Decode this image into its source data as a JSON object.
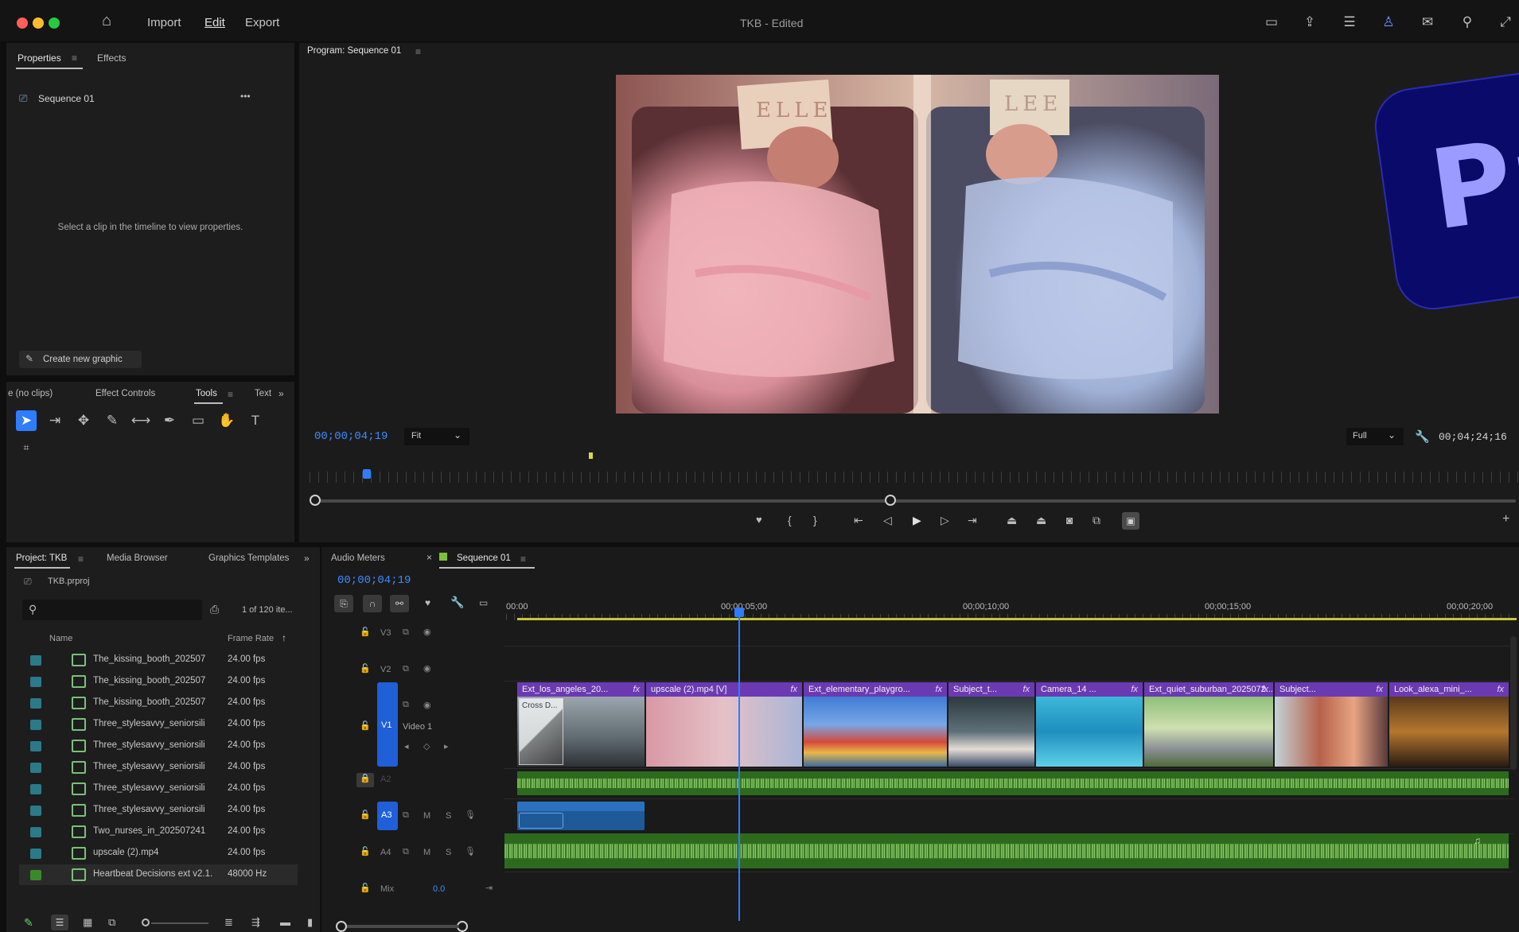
{
  "window": {
    "title": "TKB - Edited"
  },
  "menu": {
    "home": "⌂",
    "import": "Import",
    "edit": "Edit",
    "export": "Export"
  },
  "properties_panel": {
    "tab_properties": "Properties",
    "tab_effects": "Effects",
    "sequence_name": "Sequence 01",
    "more": "•••",
    "empty_message": "Select a clip in the timeline to view properties.",
    "create_graphic": "Create new graphic"
  },
  "tools_panel": {
    "tab_noclips": "e (no clips)",
    "tab_effect_controls": "Effect Controls",
    "tab_tools": "Tools",
    "tab_text": "Text",
    "overflow": "»"
  },
  "program_monitor": {
    "tab": "Program: Sequence 01",
    "timecode": "00;00;04;19",
    "fit": "Fit",
    "quality": "Full",
    "duration": "00;04;24;16",
    "frame_labels": [
      "ELLE",
      "LEE"
    ]
  },
  "project_panel": {
    "tab_project": "Project: TKB",
    "tab_media_browser": "Media Browser",
    "tab_graphics": "Graphics Templates",
    "overflow": "»",
    "file": "TKB.prproj",
    "count": "1 of 120 ite...",
    "col_name": "Name",
    "col_frame_rate": "Frame Rate",
    "items": [
      {
        "name": "The_kissing_booth_202507",
        "rate": "24.00 fps"
      },
      {
        "name": "The_kissing_booth_202507",
        "rate": "24.00 fps"
      },
      {
        "name": "The_kissing_booth_202507",
        "rate": "24.00 fps"
      },
      {
        "name": "Three_stylesavvy_seniorsili",
        "rate": "24.00 fps"
      },
      {
        "name": "Three_stylesavvy_seniorsili",
        "rate": "24.00 fps"
      },
      {
        "name": "Three_stylesavvy_seniorsili",
        "rate": "24.00 fps"
      },
      {
        "name": "Three_stylesavvy_seniorsili",
        "rate": "24.00 fps"
      },
      {
        "name": "Three_stylesavvy_seniorsili",
        "rate": "24.00 fps"
      },
      {
        "name": "Two_nurses_in_202507241",
        "rate": "24.00 fps"
      },
      {
        "name": "upscale (2).mp4",
        "rate": "24.00 fps"
      },
      {
        "name": "Heartbeat Decisions ext v2.1.",
        "rate": "48000 Hz"
      }
    ]
  },
  "timeline": {
    "tab_audio_meters": "Audio Meters",
    "tab_sequence": "Sequence 01",
    "timecode": "00;00;04;19",
    "ruler": [
      "00:00",
      "00;00;05;00",
      "00;00;10;00",
      "00;00;15;00",
      "00;00;20;00"
    ],
    "tracks": {
      "v3": "V3",
      "v2": "V2",
      "v1": "V1",
      "video1": "Video 1",
      "a2": "A2",
      "a3": "A3",
      "a4": "A4",
      "mix": "Mix",
      "mix_value": "0.0",
      "m": "M",
      "s": "S"
    },
    "video_clips": [
      "Ext_los_angeles_20...",
      "upscale (2).mp4 [V]",
      "Ext_elementary_playgro...",
      "Subject_t...",
      "Camera_14 ...",
      "Ext_quiet_suburban_2025072...",
      "Subject...",
      "Look_alexa_mini_..."
    ],
    "transition_label": "Cross D...",
    "fx": "fx"
  },
  "logo": {
    "text": "Pr"
  },
  "colors": {
    "accent_blue": "#2f7dff",
    "clip_purple": "#6b3ab3",
    "audio_green": "#2e6a1e",
    "track_blue": "#1f5fd8"
  }
}
